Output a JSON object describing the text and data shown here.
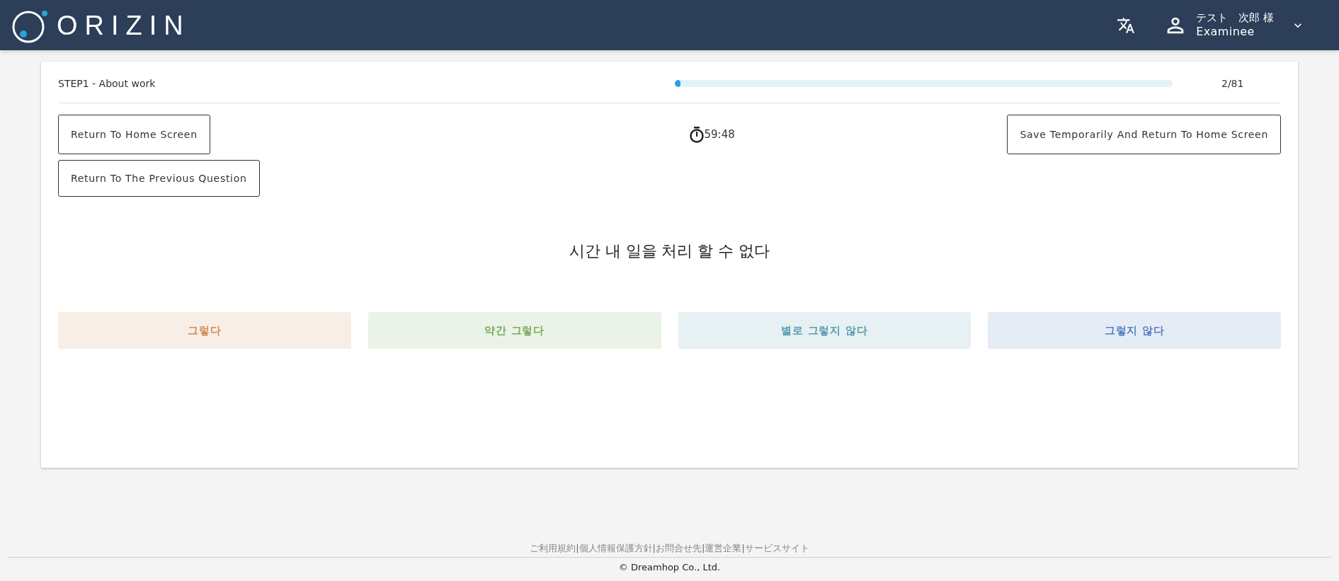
{
  "header": {
    "logo_text": "ORIZIN",
    "user_name": "テスト　次郎 様",
    "user_role": "Examinee"
  },
  "progress": {
    "step_label": "STEP1 - About work",
    "level": 0.012,
    "count": "2/81"
  },
  "buttons": {
    "home": "Return To Home Screen",
    "previous": "Return To The Previous Question",
    "save": "Save Temporarily And Return To Home Screen"
  },
  "timer": "59:48",
  "question": "시간 내 일을 처리 할 수 없다",
  "answers": [
    {
      "label": "그렇다",
      "color": "#d08a57"
    },
    {
      "label": "약간 그렇다",
      "color": "#7aab5c"
    },
    {
      "label": "별로 그렇지 않다",
      "color": "#5b9bb0"
    },
    {
      "label": "그렇지 않다",
      "color": "#5a7fc0"
    }
  ],
  "footer": {
    "links": [
      "ご利用規約",
      "個人情報保護方針",
      "お問合せ先",
      "運営企業",
      "サービスサイト"
    ],
    "separator": "|",
    "copyright": "© Dreamhop Co., Ltd."
  }
}
